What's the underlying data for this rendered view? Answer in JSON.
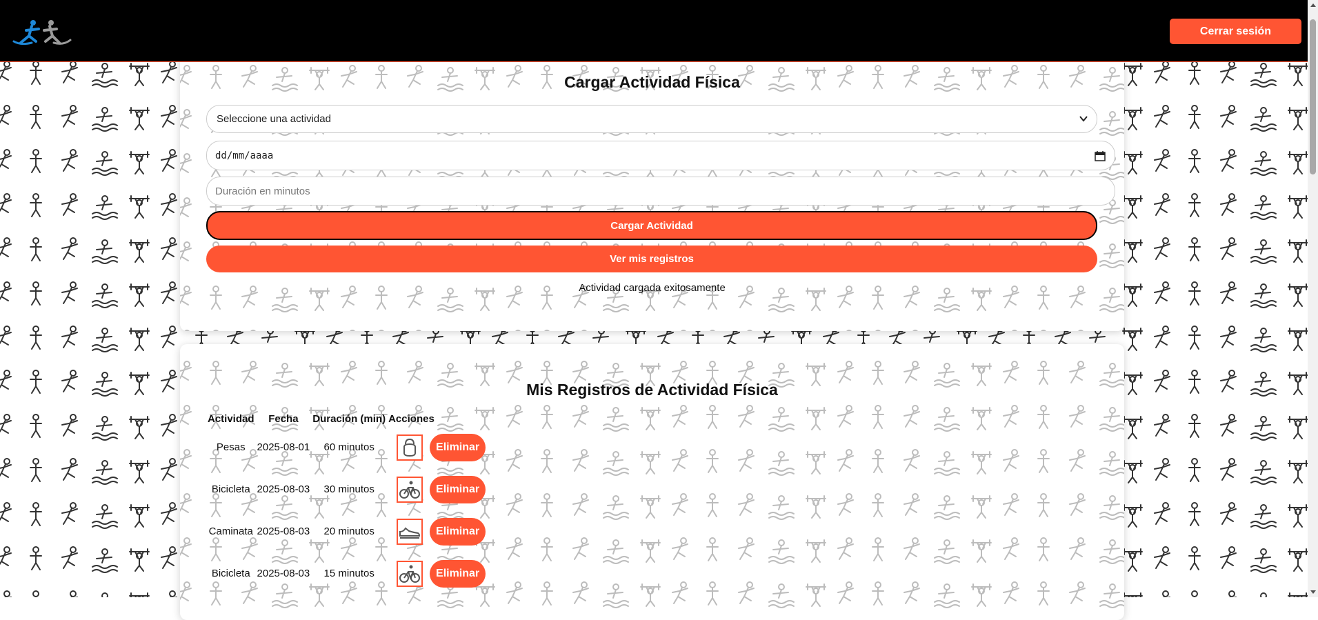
{
  "header": {
    "logout_label": "Cerrar sesión"
  },
  "form": {
    "title": "Cargar Actividad Física",
    "activity_select_value": "Seleccione una actividad",
    "date_value": "dd/mm/aaaa",
    "duration_placeholder": "Duración en minutos",
    "submit_label": "Cargar Actividad",
    "view_records_label": "Ver mis registros",
    "status_message": "Actividad cargada exitosamente"
  },
  "records": {
    "title": "Mis Registros de Actividad Física",
    "columns": [
      "Actividad",
      "Fecha",
      "Duración (min)",
      "Acciones"
    ],
    "rows": [
      {
        "activity": "Pesas",
        "date": "2025-08-01",
        "duration": "60 minutos",
        "icon": "kettlebell-icon",
        "delete_label": "Eliminar"
      },
      {
        "activity": "Bicicleta",
        "date": "2025-08-03",
        "duration": "30 minutos",
        "icon": "bicycle-icon",
        "delete_label": "Eliminar"
      },
      {
        "activity": "Caminata",
        "date": "2025-08-03",
        "duration": "20 minutos",
        "icon": "sneaker-icon",
        "delete_label": "Eliminar"
      },
      {
        "activity": "Bicicleta",
        "date": "2025-08-03",
        "duration": "15 minutos",
        "icon": "bicycle-icon",
        "delete_label": "Eliminar"
      }
    ]
  },
  "colors": {
    "accent": "#ff5533",
    "navbar": "#000000",
    "logo_blue": "#1e88d8",
    "logo_gray": "#9a9a9a"
  }
}
